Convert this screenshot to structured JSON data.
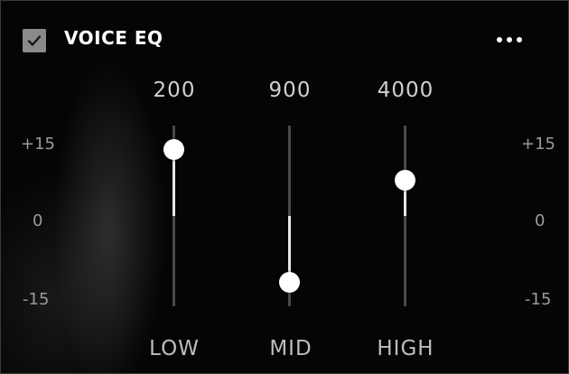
{
  "panel": {
    "title": "VOICE EQ",
    "enabled": true
  },
  "scale": {
    "top": "+15",
    "middle": "0",
    "bottom": "-15"
  },
  "sliders": [
    {
      "frequency": "200",
      "band": "LOW",
      "gain_db": 11
    },
    {
      "frequency": "900",
      "band": "MID",
      "gain_db": -11
    },
    {
      "frequency": "4000",
      "band": "HIGH",
      "gain_db": 6
    }
  ],
  "range": {
    "min_db": -15,
    "max_db": 15
  },
  "colors": {
    "background": "#050505",
    "track": "#4a4a4a",
    "fill": "#e6e6e6",
    "thumb": "#ffffff",
    "checkbox": "#8a8a8a"
  },
  "icons": {
    "checkbox": "checkmark-icon",
    "menu": "more-dots-icon"
  }
}
